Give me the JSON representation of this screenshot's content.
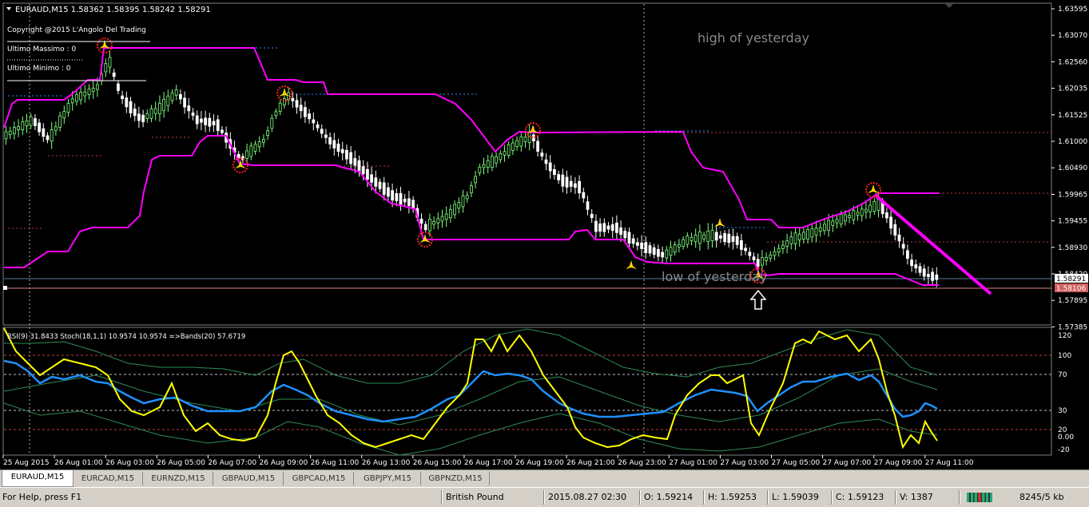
{
  "header": {
    "symbol_line": "EURAUD,M15  1.58362 1.58395 1.58242 1.58291",
    "copyright": "Copyright @2015 L'Angolo Del Trading",
    "ultimo_massimo": "Ultimo Massimo :    0",
    "ultimo_minimo": "Ultimo Minimo  :    0"
  },
  "annotations": {
    "high_label": "high of yesterday",
    "low_label": "low of yesterday"
  },
  "price_axis": {
    "ticks": [
      "1.63595",
      "1.63070",
      "1.62560",
      "1.62035",
      "1.61525",
      "1.61000",
      "1.60490",
      "1.59965",
      "1.59455",
      "1.58930",
      "1.58420",
      "1.57895",
      "1.57385"
    ],
    "current_price": "1.58291",
    "line_price": "1.58106"
  },
  "indicator": {
    "label": "RSI(9) 31.8433  Stoch(18,1,1) 10.9574 10.9574  =>Bands(20) 57.6719",
    "ticks": [
      "120",
      "100",
      "70",
      "30",
      "20",
      "0.00",
      "-20"
    ]
  },
  "time_axis": {
    "labels": [
      "25 Aug 2015",
      "26 Aug 01:00",
      "26 Aug 03:00",
      "26 Aug 05:00",
      "26 Aug 07:00",
      "26 Aug 09:00",
      "26 Aug 11:00",
      "26 Aug 13:00",
      "26 Aug 15:00",
      "26 Aug 17:00",
      "26 Aug 19:00",
      "26 Aug 21:00",
      "26 Aug 23:00",
      "27 Aug 01:00",
      "27 Aug 03:00",
      "27 Aug 05:00",
      "27 Aug 07:00",
      "27 Aug 09:00",
      "27 Aug 11:00"
    ]
  },
  "tabs": [
    "EURAUD,M15",
    "EURCAD,M15",
    "EURNZD,M15",
    "GBPAUD,M15",
    "GBPCAD,M15",
    "GBPJPY,M15",
    "GBPNZD,M15"
  ],
  "active_tab": "EURAUD,M15",
  "statusbar": {
    "help": "For Help, press F1",
    "profile": "British Pound",
    "datetime": "2015.08.27 02:30",
    "open": "O: 1.59214",
    "high": "H: 1.59253",
    "low": "L: 1.59039",
    "close": "C: 1.59123",
    "volume": "V: 1387",
    "traffic": "8245/5 kb"
  },
  "colors": {
    "background": "#000000",
    "bull_candle": "#7fff7f",
    "bear_candle": "#ffffff",
    "channel": "#ff00ff",
    "trendline": "#ff00ff",
    "stoch": "#ffff00",
    "rsi": "#1e90ff",
    "bands": "#2e8b57",
    "grid": "#808080"
  },
  "chart_data": {
    "type": "line",
    "title": "EURAUD,M15  1.58362 1.58395 1.58242 1.58291",
    "x": [
      "25 Aug 2015",
      "26 Aug 01:00",
      "26 Aug 03:00",
      "26 Aug 05:00",
      "26 Aug 07:00",
      "26 Aug 09:00",
      "26 Aug 11:00",
      "26 Aug 13:00",
      "26 Aug 15:00",
      "26 Aug 17:00",
      "26 Aug 19:00",
      "26 Aug 21:00",
      "26 Aug 23:00",
      "27 Aug 01:00",
      "27 Aug 03:00",
      "27 Aug 05:00",
      "27 Aug 07:00",
      "27 Aug 09:00",
      "27 Aug 11:00"
    ],
    "series": [
      {
        "values": [
          1.616,
          1.6175,
          1.624,
          1.616,
          1.614,
          1.619,
          1.608,
          1.599,
          1.592,
          1.602,
          1.609,
          1.594,
          1.5895,
          1.591,
          1.588,
          1.592,
          1.596,
          1.596,
          1.583
        ]
      }
    ],
    "ylim": [
      1.57385,
      1.63595
    ],
    "resistance": 1.6105,
    "support": 1.58106
  }
}
